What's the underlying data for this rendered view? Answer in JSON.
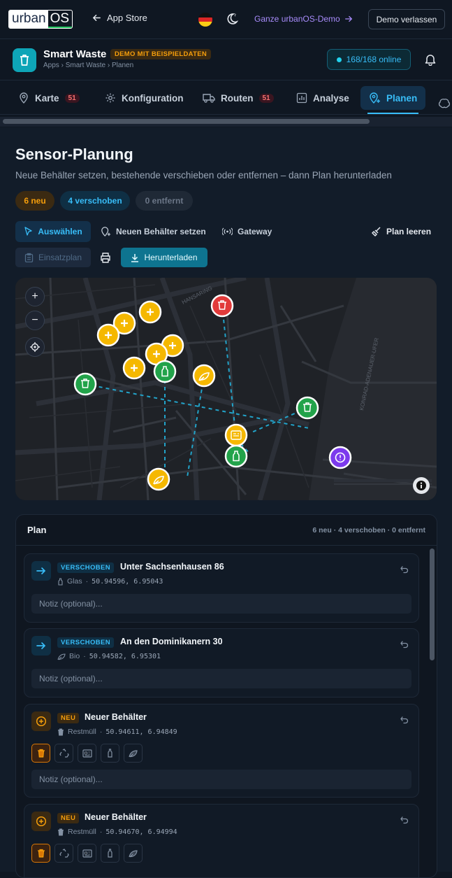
{
  "topbar": {
    "logo_a": "urban",
    "logo_b": "OS",
    "back_label": "App Store",
    "demo_link": "Ganze urbanOS-Demo",
    "exit_button": "Demo verlassen"
  },
  "app": {
    "title": "Smart Waste",
    "demo_badge": "DEMO MIT BEISPIELDATEN",
    "breadcrumb": [
      "Apps",
      "Smart Waste",
      "Planen"
    ],
    "online": "168/168 online"
  },
  "tabs": [
    {
      "label": "Karte",
      "count": "51"
    },
    {
      "label": "Konfiguration"
    },
    {
      "label": "Routen",
      "count": "51"
    },
    {
      "label": "Analyse"
    },
    {
      "label": "Planen"
    }
  ],
  "page": {
    "title": "Sensor-Planung",
    "subtitle": "Neue Behälter setzen, bestehende verschieben oder entfernen – dann Plan herunterladen",
    "pills": {
      "new": "6 neu",
      "moved": "4 verschoben",
      "removed": "0 entfernt"
    },
    "tools": {
      "select": "Auswählen",
      "place": "Neuen Behälter setzen",
      "gateway": "Gateway",
      "clear": "Plan leeren"
    },
    "actions": {
      "deployment": "Einsatzplan",
      "download": "Herunterladen"
    }
  },
  "map": {
    "street_1": "HANSARING",
    "street_2": "KONRAD-ADENAUER-UFER"
  },
  "plan": {
    "title": "Plan",
    "summary": "6 neu · 4 verschoben · 0 entfernt",
    "note_placeholder": "Notiz (optional)...",
    "items": [
      {
        "badge": "VERSCHOBEN",
        "name": "Unter Sachsenhausen 86",
        "type": "Glas",
        "coords": "50.94596, 6.95043"
      },
      {
        "badge": "VERSCHOBEN",
        "name": "An den Dominikanern 30",
        "type": "Bio",
        "coords": "50.94582, 6.95301"
      },
      {
        "badge": "NEU",
        "name": "Neuer Behälter",
        "type": "Restmüll",
        "coords": "50.94611, 6.94849"
      },
      {
        "badge": "NEU",
        "name": "Neuer Behälter",
        "type": "Restmüll",
        "coords": "50.94670, 6.94994"
      }
    ]
  },
  "colors": {
    "accent": "#38bdf8",
    "new": "#f59e0b",
    "moved": "#38bdf8",
    "removed": "#ef4444",
    "glass": "#22a34a",
    "demo": "#a78bfa"
  }
}
